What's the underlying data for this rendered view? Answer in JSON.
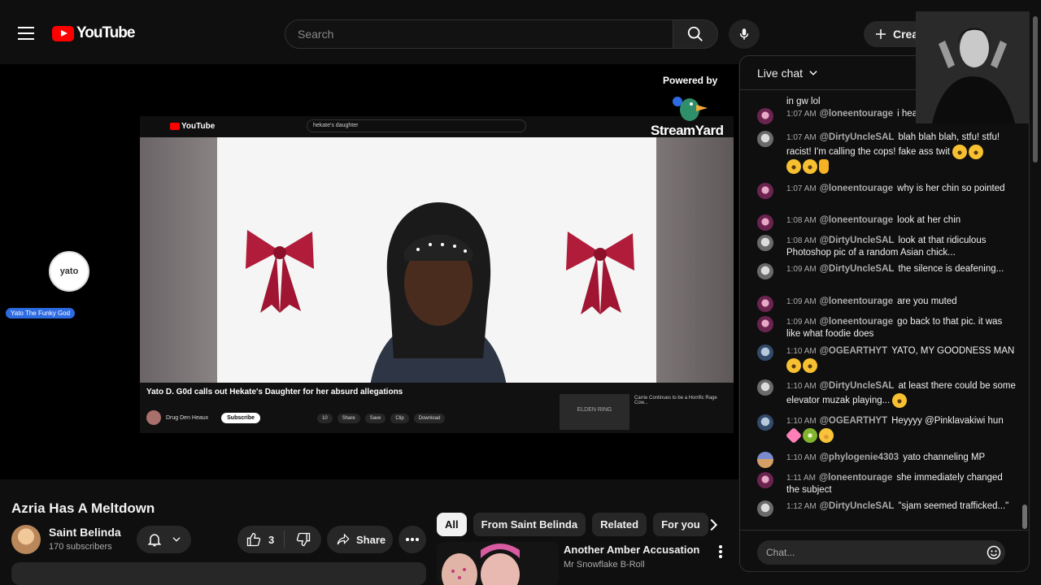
{
  "topbar": {
    "logo_text": "YouTube",
    "search_placeholder": "Search",
    "create_label": "Create"
  },
  "player": {
    "powered_by": "Powered by",
    "streamyard": "StreamYard",
    "guest_name": "Yato The Funky God",
    "guest_avatar_text": "yato",
    "inner": {
      "logo_text": "YouTube",
      "search_text": "hekate's daughter",
      "video_title": "Yato D. G0d calls out Hekate's Daughter for her absurd allegations",
      "channel_name": "Drug Den Heaux",
      "subscribe_label": "Subscribe",
      "like_count": "10",
      "actions": [
        "Share",
        "Save",
        "Clip",
        "Download"
      ],
      "side_thumb_text": "ELDEN RING",
      "side_title": "Carrie Continues to be a Horrific Rage Cow..."
    }
  },
  "video": {
    "title": "Azria Has A Meltdown",
    "channel_name": "Saint Belinda",
    "subscribers": "170 subscribers",
    "like_count": "3",
    "share_label": "Share"
  },
  "chips": [
    "All",
    "From Saint Belinda",
    "Related",
    "For you"
  ],
  "recommendation": {
    "title": "Another Amber Accusation",
    "channel": "Mr Snowflake B-Roll"
  },
  "chat": {
    "title": "Live chat",
    "input_placeholder": "Chat...",
    "messages": [
      {
        "time": "",
        "author": "",
        "text": "in gw lol",
        "avatar": "lone"
      },
      {
        "time": "1:07 AM",
        "author": "@loneentourage",
        "text": "i hear",
        "avatar": "lone"
      },
      {
        "time": "1:07 AM",
        "author": "@DirtyUncleSAL",
        "text": "blah blah blah, stfu! stfu! racist! I'm calling the cops! fake ass twit",
        "avatar": "dirty"
      },
      {
        "time": "1:07 AM",
        "author": "@loneentourage",
        "text": "why is her chin so pointed",
        "avatar": "lone"
      },
      {
        "time": "1:08 AM",
        "author": "@loneentourage",
        "text": "look at her chin",
        "avatar": "lone"
      },
      {
        "time": "1:08 AM",
        "author": "@DirtyUncleSAL",
        "text": "look at that ridiculous Photoshop pic of a random Asian chick...",
        "avatar": "dirty"
      },
      {
        "time": "1:09 AM",
        "author": "@DirtyUncleSAL",
        "text": "the silence is deafening...",
        "avatar": "dirty"
      },
      {
        "time": "1:09 AM",
        "author": "@loneentourage",
        "text": "are you muted",
        "avatar": "lone"
      },
      {
        "time": "1:09 AM",
        "author": "@loneentourage",
        "text": "go back to that pic. it was like what foodie does",
        "avatar": "lone"
      },
      {
        "time": "1:10 AM",
        "author": "@OGEARTHYT",
        "text": "YATO, MY GOODNESS MAN",
        "avatar": "og"
      },
      {
        "time": "1:10 AM",
        "author": "@DirtyUncleSAL",
        "text": "at least there could be some elevator muzak playing...",
        "avatar": "dirty"
      },
      {
        "time": "1:10 AM",
        "author": "@OGEARTHYT",
        "text": "Heyyyy @Pinklavakiwi hun",
        "avatar": "og"
      },
      {
        "time": "1:10 AM",
        "author": "@phylogenie4303",
        "text": "yato channeling MP",
        "avatar": "phy"
      },
      {
        "time": "1:11 AM",
        "author": "@loneentourage",
        "text": "she immediately changed the subject",
        "avatar": "lone"
      },
      {
        "time": "1:12 AM",
        "author": "@DirtyUncleSAL",
        "text": "\"sjam seemed trafficked...\"",
        "avatar": "dirty"
      }
    ]
  }
}
